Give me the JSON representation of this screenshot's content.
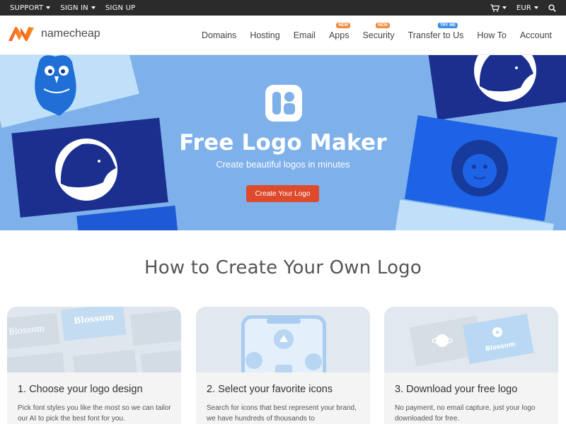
{
  "topbar": {
    "support": "SUPPORT",
    "sign_in": "SIGN IN",
    "sign_up": "SIGN UP",
    "currency": "EUR"
  },
  "brand": {
    "name": "namecheap"
  },
  "nav": {
    "items": [
      {
        "label": "Domains",
        "badge": ""
      },
      {
        "label": "Hosting",
        "badge": ""
      },
      {
        "label": "Email",
        "badge": ""
      },
      {
        "label": "Apps",
        "badge": "NEW"
      },
      {
        "label": "Security",
        "badge": "NEW"
      },
      {
        "label": "Transfer to Us",
        "badge": "TRY ME"
      },
      {
        "label": "How To",
        "badge": ""
      },
      {
        "label": "Account",
        "badge": ""
      }
    ]
  },
  "hero": {
    "title": "Free Logo Maker",
    "subtitle": "Create beautiful logos in minutes",
    "cta": "Create Your Logo",
    "card_text_a": "Blossom",
    "card_text_b": "Blossom",
    "card_text_c": "Blossom"
  },
  "section": {
    "title": "How to Create Your Own Logo",
    "steps": [
      {
        "title": "1. Choose your logo design",
        "desc": "Pick font styles you like the most so we can tailor our AI to pick the best font for you."
      },
      {
        "title": "2. Select your favorite icons",
        "desc": "Search for icons that best represent your brand, we have hundreds of thousands to"
      },
      {
        "title": "3. Download your free logo",
        "desc": "No payment, no email capture, just your logo downloaded for free."
      }
    ]
  },
  "colors": {
    "topbar_bg": "#2b2b2b",
    "hero_bg": "#7eb0ea",
    "cta_bg": "#de4a2c",
    "brand_orange": "#f3662d",
    "badge_orange": "#f08a3c",
    "badge_blue": "#3a8ee6"
  },
  "icons": [
    "chevron-down-icon",
    "cart-icon",
    "search-icon",
    "namecheap-logo-icon",
    "logo-maker-app-icon"
  ]
}
